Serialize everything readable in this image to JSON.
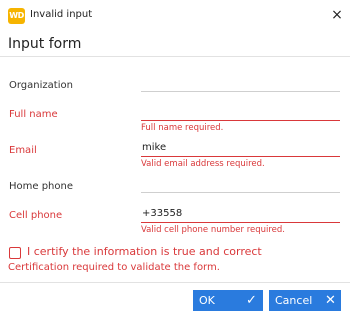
{
  "window": {
    "icon_text": "WD",
    "title": "Invalid input",
    "close_symbol": "×"
  },
  "form": {
    "header": "Input form",
    "fields": [
      {
        "label": "Organization",
        "value": "",
        "error": ""
      },
      {
        "label": "Full name",
        "value": "",
        "error": "Full name required."
      },
      {
        "label": "Email",
        "value": "mike",
        "error": "Valid email address required."
      },
      {
        "label": "Home phone",
        "value": "",
        "error": ""
      },
      {
        "label": "Cell phone",
        "value": "+33558",
        "error": "Valid cell phone number required."
      }
    ],
    "certify": {
      "label": "I certify the information is true and correct",
      "checked": false,
      "error": "Certification required to validate the form."
    }
  },
  "buttons": {
    "ok": {
      "label": "OK",
      "icon": "check-icon"
    },
    "cancel": {
      "label": "Cancel",
      "icon": "close-icon"
    }
  },
  "colors": {
    "error": "#d9383a",
    "accent": "#2a7bde",
    "app_icon": "#f6b400"
  }
}
